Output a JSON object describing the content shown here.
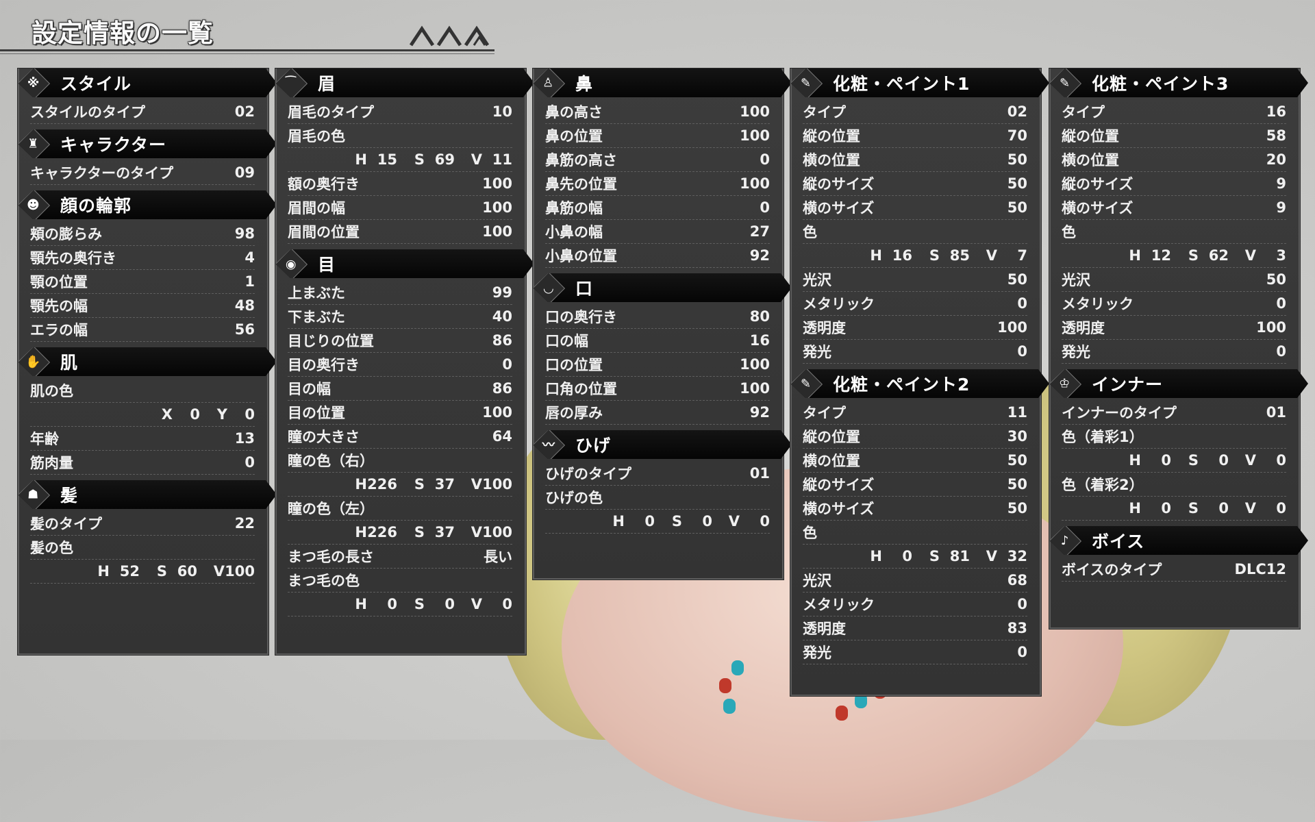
{
  "page_title": "設定情報の一覧",
  "sections": {
    "style": {
      "title": "スタイル",
      "icon": "sparkle-icon",
      "rows": [
        {
          "label": "スタイルのタイプ",
          "value": "02"
        }
      ]
    },
    "character": {
      "title": "キャラクター",
      "icon": "character-icon",
      "rows": [
        {
          "label": "キャラクターのタイプ",
          "value": "09"
        }
      ]
    },
    "face": {
      "title": "顔の輪郭",
      "icon": "face-icon",
      "rows": [
        {
          "label": "頬の膨らみ",
          "value": "98"
        },
        {
          "label": "顎先の奥行き",
          "value": "4"
        },
        {
          "label": "顎の位置",
          "value": "1"
        },
        {
          "label": "顎先の幅",
          "value": "48"
        },
        {
          "label": "エラの幅",
          "value": "56"
        }
      ]
    },
    "skin": {
      "title": "肌",
      "icon": "hand-icon",
      "color_label": "肌の色",
      "x": "0",
      "y": "0",
      "rows": [
        {
          "label": "年齢",
          "value": "13"
        },
        {
          "label": "筋肉量",
          "value": "0"
        }
      ]
    },
    "hair": {
      "title": "髪",
      "icon": "hair-icon",
      "rows": [
        {
          "label": "髪のタイプ",
          "value": "22"
        }
      ],
      "color_label": "髪の色",
      "h": "52",
      "s": "60",
      "v": "100"
    },
    "brow": {
      "title": "眉",
      "icon": "eyebrow-icon",
      "type_label": "眉毛のタイプ",
      "type_value": "10",
      "color_label": "眉毛の色",
      "h": "15",
      "s": "69",
      "v": "11",
      "rows": [
        {
          "label": "額の奥行き",
          "value": "100"
        },
        {
          "label": "眉間の幅",
          "value": "100"
        },
        {
          "label": "眉間の位置",
          "value": "100"
        }
      ]
    },
    "eye": {
      "title": "目",
      "icon": "eye-icon",
      "rows": [
        {
          "label": "上まぶた",
          "value": "99"
        },
        {
          "label": "下まぶた",
          "value": "40"
        },
        {
          "label": "目じりの位置",
          "value": "86"
        },
        {
          "label": "目の奥行き",
          "value": "0"
        },
        {
          "label": "目の幅",
          "value": "86"
        },
        {
          "label": "目の位置",
          "value": "100"
        },
        {
          "label": "瞳の大きさ",
          "value": "64"
        }
      ],
      "pupil_right_label": "瞳の色（右）",
      "pr_h": "226",
      "pr_s": "37",
      "pr_v": "100",
      "pupil_left_label": "瞳の色（左）",
      "pl_h": "226",
      "pl_s": "37",
      "pl_v": "100",
      "lash_len_label": "まつ毛の長さ",
      "lash_len_value": "長い",
      "lash_color_label": "まつ毛の色",
      "lc_h": "0",
      "lc_s": "0",
      "lc_v": "0"
    },
    "nose": {
      "title": "鼻",
      "icon": "nose-icon",
      "rows": [
        {
          "label": "鼻の高さ",
          "value": "100"
        },
        {
          "label": "鼻の位置",
          "value": "100"
        },
        {
          "label": "鼻筋の高さ",
          "value": "0"
        },
        {
          "label": "鼻先の位置",
          "value": "100"
        },
        {
          "label": "鼻筋の幅",
          "value": "0"
        },
        {
          "label": "小鼻の幅",
          "value": "27"
        },
        {
          "label": "小鼻の位置",
          "value": "92"
        }
      ]
    },
    "mouth": {
      "title": "口",
      "icon": "mouth-icon",
      "rows": [
        {
          "label": "口の奥行き",
          "value": "80"
        },
        {
          "label": "口の幅",
          "value": "16"
        },
        {
          "label": "口の位置",
          "value": "100"
        },
        {
          "label": "口角の位置",
          "value": "100"
        },
        {
          "label": "唇の厚み",
          "value": "92"
        }
      ]
    },
    "beard": {
      "title": "ひげ",
      "icon": "mustache-icon",
      "type_label": "ひげのタイプ",
      "type_value": "01",
      "color_label": "ひげの色",
      "h": "0",
      "s": "0",
      "v": "0"
    },
    "paint1": {
      "title": "化粧・ペイント1",
      "icon": "paint-icon",
      "rows": [
        {
          "label": "タイプ",
          "value": "02"
        },
        {
          "label": "縦の位置",
          "value": "70"
        },
        {
          "label": "横の位置",
          "value": "50"
        },
        {
          "label": "縦のサイズ",
          "value": "50"
        },
        {
          "label": "横のサイズ",
          "value": "50"
        }
      ],
      "color_label": "色",
      "h": "16",
      "s": "85",
      "v": "7",
      "rows2": [
        {
          "label": "光沢",
          "value": "50"
        },
        {
          "label": "メタリック",
          "value": "0"
        },
        {
          "label": "透明度",
          "value": "100"
        },
        {
          "label": "発光",
          "value": "0"
        }
      ]
    },
    "paint2": {
      "title": "化粧・ペイント2",
      "icon": "paint-icon",
      "rows": [
        {
          "label": "タイプ",
          "value": "11"
        },
        {
          "label": "縦の位置",
          "value": "30"
        },
        {
          "label": "横の位置",
          "value": "50"
        },
        {
          "label": "縦のサイズ",
          "value": "50"
        },
        {
          "label": "横のサイズ",
          "value": "50"
        }
      ],
      "color_label": "色",
      "h": "0",
      "s": "81",
      "v": "32",
      "rows2": [
        {
          "label": "光沢",
          "value": "68"
        },
        {
          "label": "メタリック",
          "value": "0"
        },
        {
          "label": "透明度",
          "value": "83"
        },
        {
          "label": "発光",
          "value": "0"
        }
      ]
    },
    "paint3": {
      "title": "化粧・ペイント3",
      "icon": "paint-icon",
      "rows": [
        {
          "label": "タイプ",
          "value": "16"
        },
        {
          "label": "縦の位置",
          "value": "58"
        },
        {
          "label": "横の位置",
          "value": "20"
        },
        {
          "label": "縦のサイズ",
          "value": "9"
        },
        {
          "label": "横のサイズ",
          "value": "9"
        }
      ],
      "color_label": "色",
      "h": "12",
      "s": "62",
      "v": "3",
      "rows2": [
        {
          "label": "光沢",
          "value": "50"
        },
        {
          "label": "メタリック",
          "value": "0"
        },
        {
          "label": "透明度",
          "value": "100"
        },
        {
          "label": "発光",
          "value": "0"
        }
      ]
    },
    "inner": {
      "title": "インナー",
      "icon": "inner-icon",
      "type_label": "インナーのタイプ",
      "type_value": "01",
      "c1_label": "色（着彩1）",
      "c1_h": "0",
      "c1_s": "0",
      "c1_v": "0",
      "c2_label": "色（着彩2）",
      "c2_h": "0",
      "c2_s": "0",
      "c2_v": "0"
    },
    "voice": {
      "title": "ボイス",
      "icon": "voice-icon",
      "rows": [
        {
          "label": "ボイスのタイプ",
          "value": "DLC12"
        }
      ]
    }
  },
  "hsv_keys": {
    "h": "H",
    "s": "S",
    "v": "V",
    "x": "X",
    "y": "Y"
  }
}
